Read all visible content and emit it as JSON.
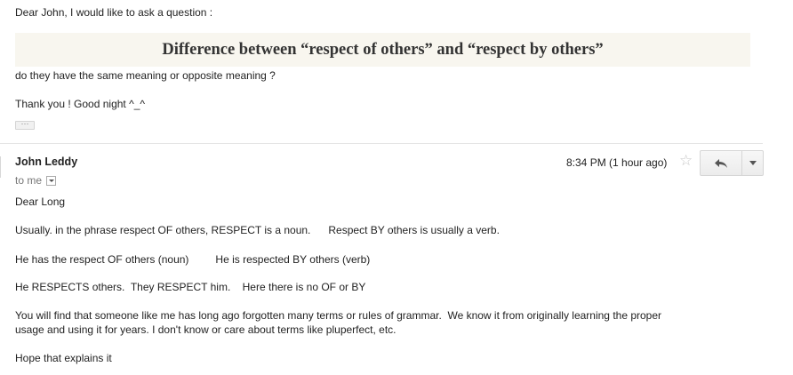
{
  "quoted_message": {
    "greeting": "Dear John, I would like to ask a question :",
    "heading": "Difference between “respect of others” and “respect by others”",
    "question": "do they have the same meaning or opposite meaning ?",
    "thanks": "Thank you ! Good night ^_^",
    "show_trimmed_label": "···"
  },
  "reply_header": {
    "sender": "John Leddy",
    "to_label": "to me",
    "timestamp": "8:34 PM (1 hour ago)",
    "star_icon": "star-icon",
    "reply_icon": "reply-arrow-icon",
    "more_icon": "dropdown-arrow-icon"
  },
  "reply_body": {
    "line1": "Dear Long",
    "line2": "Usually. in the phrase respect OF others, RESPECT is a noun.      Respect BY others is usually a verb.",
    "line3": "He has the respect OF others (noun)         He is respected BY others (verb)",
    "line4": "He RESPECTS others.  They RESPECT him.    Here there is no OF or BY",
    "line5a": "You will find that someone like me has long ago forgotten many terms or rules of grammar.  We know it from originally learning the proper",
    "line5b": "usage and using it for years. I don't know or care about terms like pluperfect, etc.",
    "line6": "Hope that explains it"
  },
  "colors": {
    "quote_background": "#f8f6ef",
    "metadata_gray": "#777777",
    "text": "#222222"
  }
}
